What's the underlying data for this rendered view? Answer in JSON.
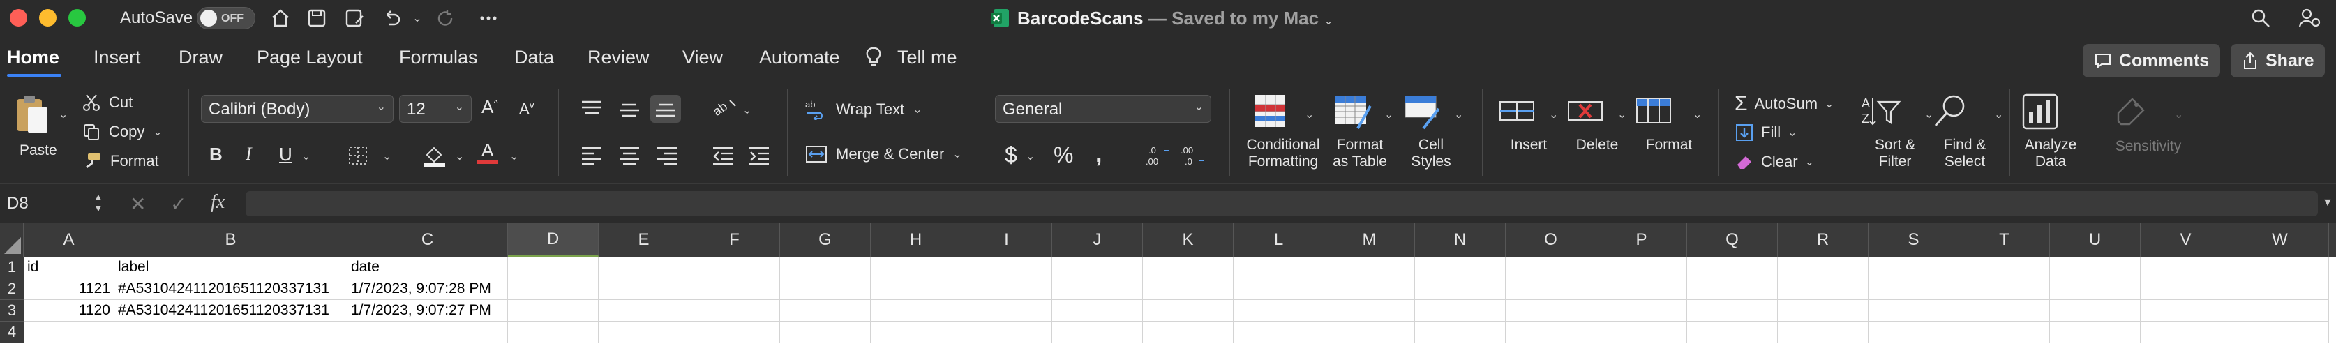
{
  "titlebar": {
    "autosave_label": "AutoSave",
    "autosave_state": "OFF",
    "doc_name": "BarcodeScans",
    "doc_status": " — Saved to my Mac"
  },
  "tabs": [
    "Home",
    "Insert",
    "Draw",
    "Page Layout",
    "Formulas",
    "Data",
    "Review",
    "View",
    "Automate",
    "Tell me"
  ],
  "active_tab": "Home",
  "header_buttons": {
    "comments": "Comments",
    "share": "Share"
  },
  "ribbon": {
    "paste": "Paste",
    "cut": "Cut",
    "copy": "Copy",
    "format_painter": "Format",
    "font_name": "Calibri (Body)",
    "font_size": "12",
    "wrap_text": "Wrap Text",
    "merge_center": "Merge & Center",
    "number_format": "General",
    "conditional_formatting": "Conditional\nFormatting",
    "format_as_table": "Format\nas Table",
    "cell_styles": "Cell\nStyles",
    "insert": "Insert",
    "delete": "Delete",
    "format": "Format",
    "autosum": "AutoSum",
    "fill": "Fill",
    "clear": "Clear",
    "sort_filter": "Sort &\nFilter",
    "find_select": "Find &\nSelect",
    "analyze_data": "Analyze\nData",
    "sensitivity": "Sensitivity"
  },
  "formula_bar": {
    "name_box": "D8",
    "fx": "fx",
    "value": ""
  },
  "columns": [
    "A",
    "B",
    "C",
    "D",
    "E",
    "F",
    "G",
    "H",
    "I",
    "J",
    "K",
    "L",
    "M",
    "N",
    "O",
    "P",
    "Q",
    "R",
    "S",
    "T",
    "U",
    "V",
    "W"
  ],
  "selected_column": "D",
  "rows": [
    {
      "num": "1",
      "cells": [
        "id",
        "label",
        "date"
      ]
    },
    {
      "num": "2",
      "cells": [
        "1121",
        "#A531042411201651120337131",
        "1/7/2023, 9:07:28 PM"
      ]
    },
    {
      "num": "3",
      "cells": [
        "1120",
        "#A531042411201651120337131",
        "1/7/2023, 9:07:27 PM"
      ]
    },
    {
      "num": "4",
      "cells": [
        "",
        "",
        ""
      ]
    }
  ],
  "colors": {
    "accent": "#3b82f6",
    "excel_green": "#1e7145"
  }
}
